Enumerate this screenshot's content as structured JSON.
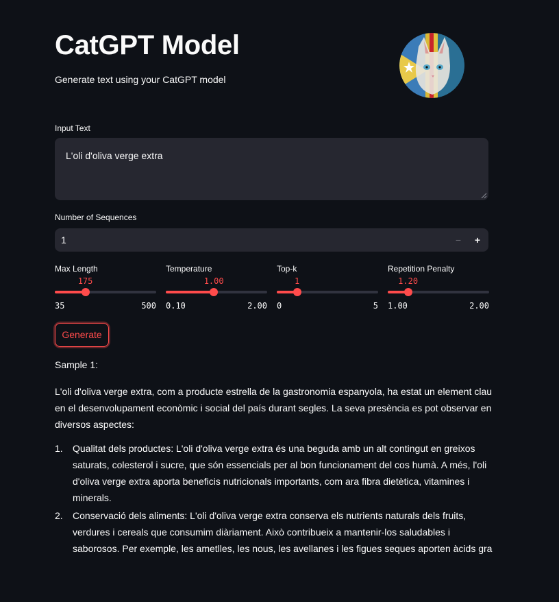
{
  "header": {
    "title": "CatGPT Model",
    "subtitle": "Generate text using your CatGPT model"
  },
  "input_text": {
    "label": "Input Text",
    "value": "L'oli d'oliva verge extra"
  },
  "num_sequences": {
    "label": "Number of Sequences",
    "value": "1",
    "minus_label": "−",
    "plus_label": "+"
  },
  "sliders": [
    {
      "label": "Max Length",
      "value": "175",
      "min": "35",
      "max": "500",
      "fraction": 0.301
    },
    {
      "label": "Temperature",
      "value": "1.00",
      "min": "0.10",
      "max": "2.00",
      "fraction": 0.474
    },
    {
      "label": "Top-k",
      "value": "1",
      "min": "0",
      "max": "5",
      "fraction": 0.2
    },
    {
      "label": "Repetition Penalty",
      "value": "1.20",
      "min": "1.00",
      "max": "2.00",
      "fraction": 0.2
    }
  ],
  "generate_button": {
    "label": "Generate"
  },
  "output": {
    "heading": "Sample 1:",
    "intro": "L'oli d'oliva verge extra, com a producte estrella de la gastronomia espanyola, ha estat un element clau en el desenvolupament econòmic i social del país durant segles. La seva presència es pot observar en diversos aspectes:",
    "items": [
      {
        "num": "1.",
        "text": "Qualitat dels productes: L'oli d'oliva verge extra és una beguda amb un alt contingut en greixos saturats, colesterol i sucre, que són essencials per al bon funcionament del cos humà. A més, l'oli d'oliva verge extra aporta beneficis nutricionals importants, com ara fibra dietètica, vitamines i minerals."
      },
      {
        "num": "2.",
        "text": "Conservació dels aliments: L'oli d'oliva verge extra conserva els nutrients naturals dels fruits, verdures i cereals que consumim diàriament. Això contribueix a mantenir-los saludables i saborosos. Per exemple, les ametlles, les nous, les avellanes i les figues seques aporten àcids gra"
      }
    ]
  },
  "colors": {
    "background": "#0e1117",
    "accent": "#ff4b4b",
    "input_bg": "#262730"
  }
}
